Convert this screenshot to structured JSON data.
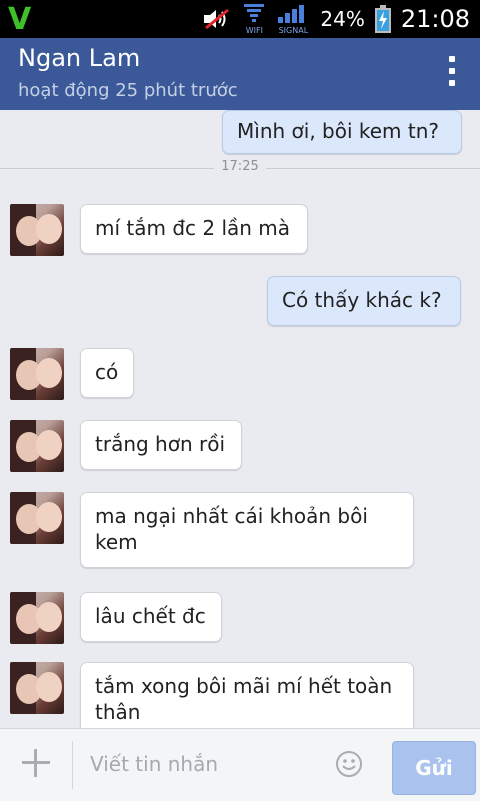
{
  "status_bar": {
    "battery": "24%",
    "time": "21:08",
    "wifi_label": "WIFI",
    "signal_label": "SIGNAL",
    "icons": [
      "volume-muted-icon",
      "wifi-icon",
      "signal-icon",
      "battery-charging-icon"
    ],
    "colors": {
      "carrier_logo": "#3fbf2a"
    }
  },
  "header": {
    "name": "Ngan Lam",
    "status": "hoạt động 25 phút trước",
    "color": "#3b5998"
  },
  "conversation": {
    "timestamp": "17:25",
    "messages": [
      {
        "from": "me",
        "text": "Mình ơi, bôi kem tn?"
      },
      {
        "from": "them",
        "text": "mí tắm đc 2 lần mà"
      },
      {
        "from": "me",
        "text": "Có thấy khác k?"
      },
      {
        "from": "them",
        "text": "có"
      },
      {
        "from": "them",
        "text": "trắng hơn rồi"
      },
      {
        "from": "them",
        "text": "ma ngại nhất cái khoản bôi kem"
      },
      {
        "from": "them",
        "text": "lâu chết đc"
      },
      {
        "from": "them",
        "text": "tắm xong bôi mãi mí hết toàn thân"
      }
    ]
  },
  "composer": {
    "placeholder": "Viết tin nhắn",
    "send_label": "Gửi"
  }
}
